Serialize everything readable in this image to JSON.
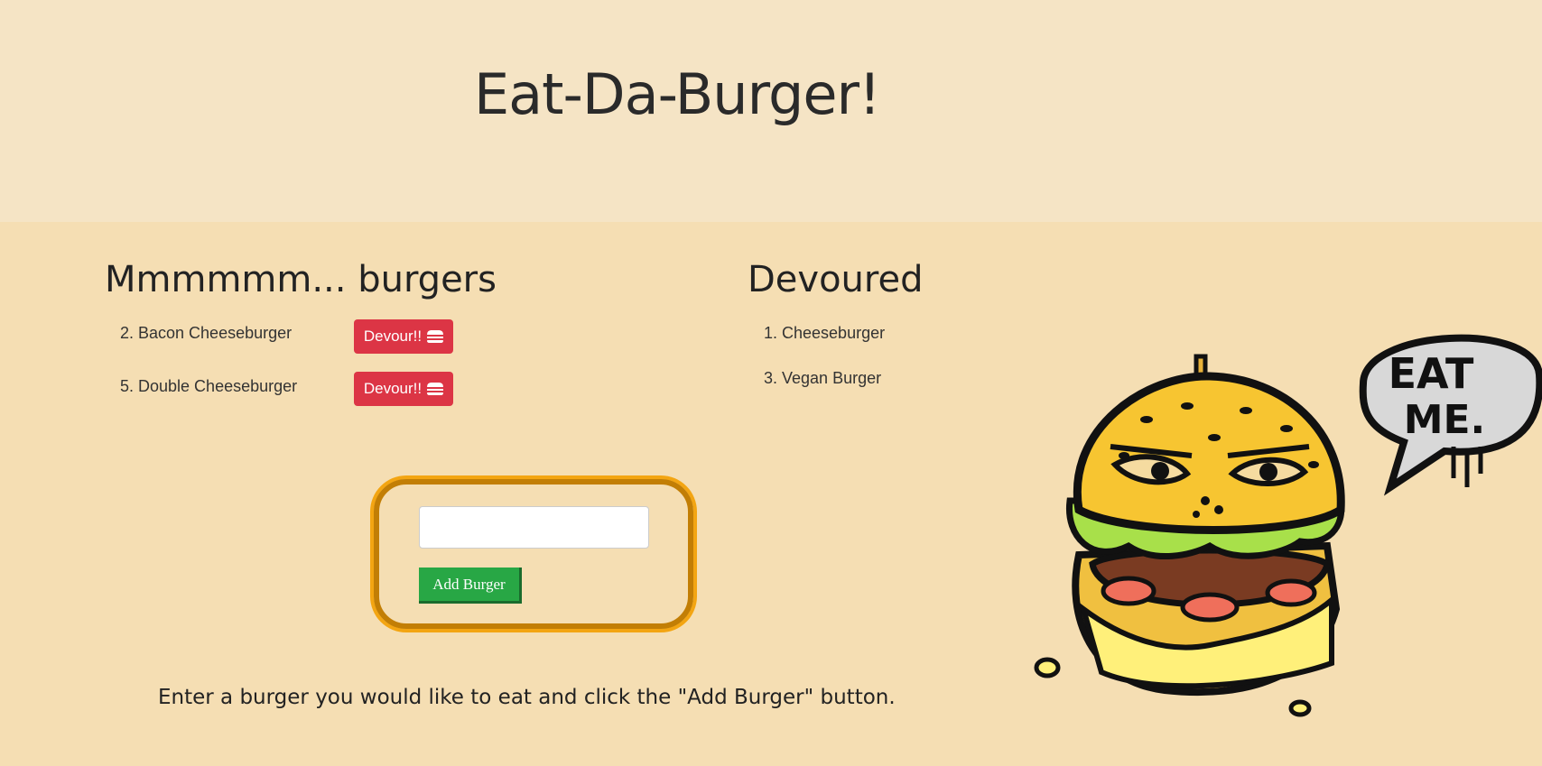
{
  "header": {
    "title": "Eat-Da-Burger!"
  },
  "uneaten": {
    "title": "Mmmmmm... burgers",
    "items": [
      {
        "label": "2. Bacon Cheeseburger",
        "button": "Devour!!"
      },
      {
        "label": "5. Double Cheeseburger",
        "button": "Devour!!"
      }
    ]
  },
  "devoured": {
    "title": "Devoured",
    "items": [
      {
        "label": "1. Cheeseburger"
      },
      {
        "label": "3. Vegan Burger"
      }
    ]
  },
  "form": {
    "input_value": "",
    "input_placeholder": "",
    "submit_label": "Add Burger"
  },
  "instructions": "Enter a burger you would like to eat and click the \"Add Burger\" button.",
  "illustration": {
    "name": "burger-monster-icon",
    "speech_text_line1": "EAT",
    "speech_text_line2": "ME."
  },
  "colors": {
    "header_bg": "#f5e4c5",
    "page_bg": "#f5deb3",
    "danger": "#dc3545",
    "success": "#28a745",
    "form_border": "#c27e05"
  },
  "icons": {
    "devour_button_icon": "hamburger-icon"
  }
}
